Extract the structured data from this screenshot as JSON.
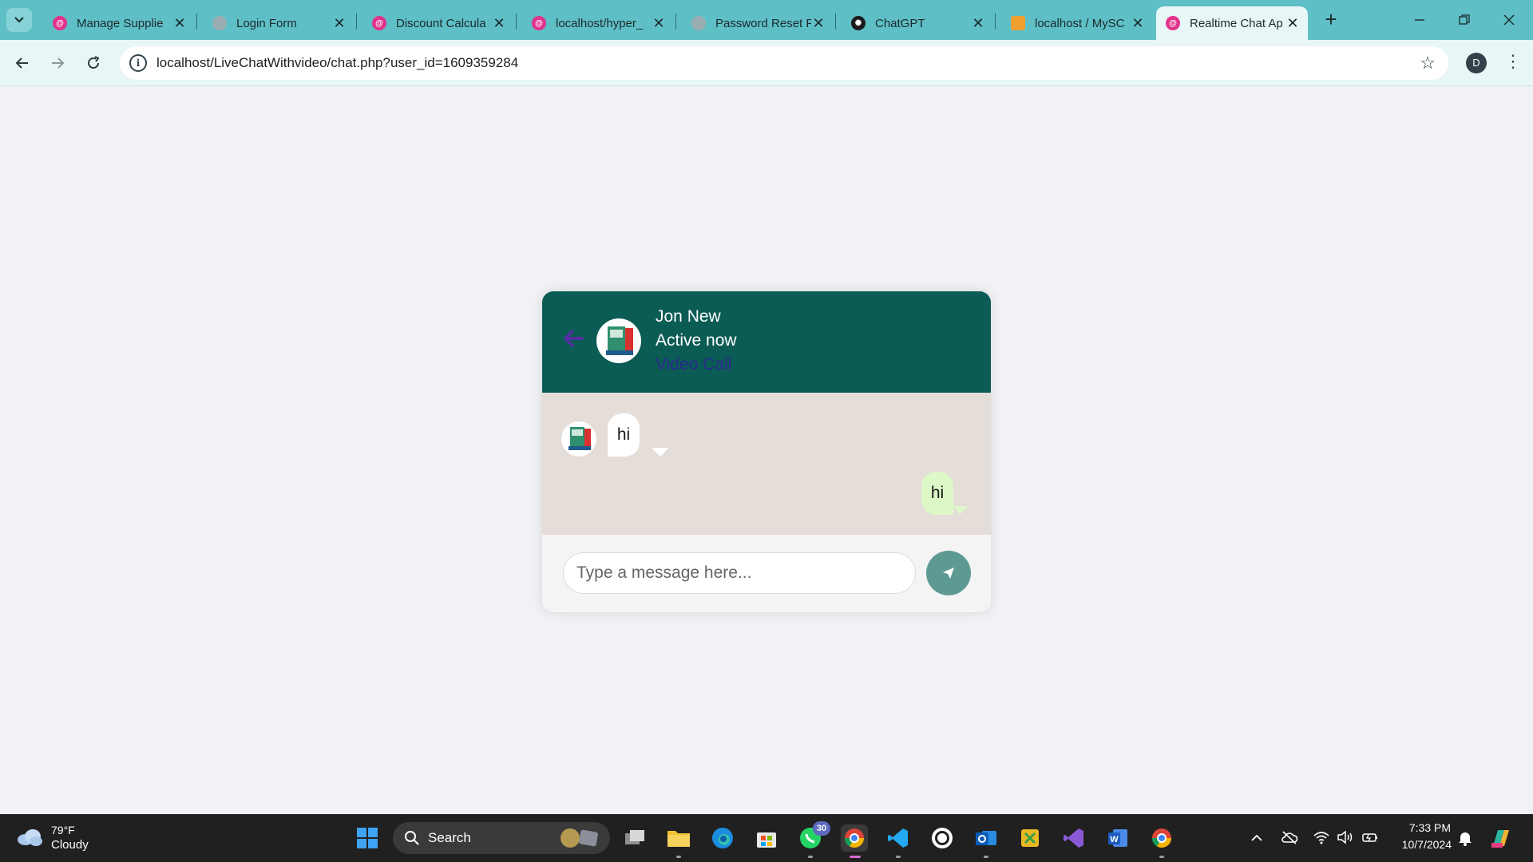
{
  "browser": {
    "tabs": [
      {
        "title": "Manage Supplie",
        "favicon": "php-elephant-icon",
        "color": "#e2338c"
      },
      {
        "title": "Login Form",
        "favicon": "globe-icon",
        "color": "#9aaeb1"
      },
      {
        "title": "Discount Calcula",
        "favicon": "php-elephant-icon",
        "color": "#e2338c"
      },
      {
        "title": "localhost/hyper_",
        "favicon": "php-elephant-icon",
        "color": "#e2338c"
      },
      {
        "title": "Password Reset F",
        "favicon": "globe-icon",
        "color": "#9aaeb1"
      },
      {
        "title": "ChatGPT",
        "favicon": "chatgpt-icon",
        "color": "#1b1b1b"
      },
      {
        "title": "localhost / MySC",
        "favicon": "phpmyadmin-icon",
        "color": "#f0a030"
      },
      {
        "title": "Realtime Chat Ap",
        "favicon": "php-elephant-icon",
        "color": "#e2338c"
      }
    ],
    "new_tab": "+",
    "url": "localhost/LiveChatWithvideo/chat.php?user_id=1609359284",
    "profile_initial": "D"
  },
  "chat": {
    "contact_name": "Jon New",
    "status": "Active now",
    "video_call": "Video Call",
    "messages": [
      {
        "direction": "incoming",
        "text": "hi"
      },
      {
        "direction": "outgoing",
        "text": "hi"
      }
    ],
    "input_placeholder": "Type a message here...",
    "colors": {
      "header": "#0b5c54",
      "chat_bg": "#e5ddd8",
      "outgoing": "#dcf8c6",
      "send_button": "#5d9a92",
      "video_call_link": "#2a2a8f"
    }
  },
  "taskbar": {
    "weather_temp": "79°F",
    "weather_condition": "Cloudy",
    "search_label": "Search",
    "whatsapp_badge": "30",
    "time": "7:33 PM",
    "date": "10/7/2024"
  }
}
